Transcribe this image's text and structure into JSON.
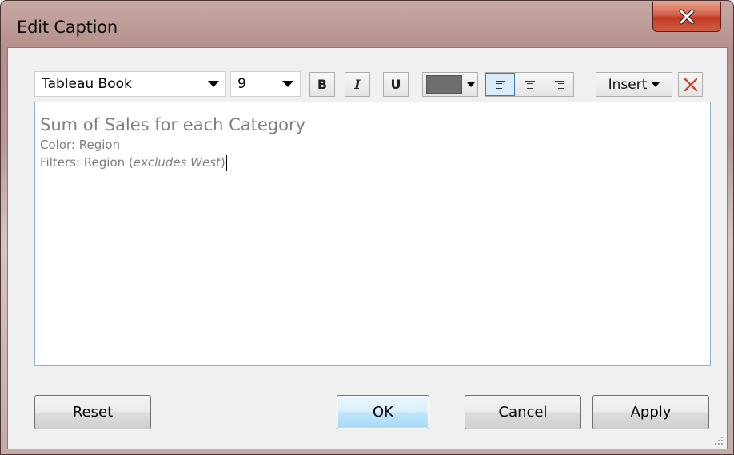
{
  "window": {
    "title": "Edit Caption"
  },
  "toolbar": {
    "font_family": "Tableau Book",
    "font_size": "9",
    "bold_label": "B",
    "italic_label": "I",
    "underline_label": "U",
    "text_color": "#6e6e6e",
    "insert_label": "Insert",
    "alignment_selected": "left"
  },
  "caption": {
    "title": "Sum of Sales for each Category",
    "color_line": "Color: Region",
    "filters_prefix": "Filters: Region (",
    "filters_italic": "excludes West",
    "filters_suffix": ")"
  },
  "buttons": {
    "reset": "Reset",
    "ok": "OK",
    "cancel": "Cancel",
    "apply": "Apply"
  },
  "icons": [
    "close-icon",
    "dropdown-arrow-icon",
    "align-left-icon",
    "align-center-icon",
    "align-right-icon",
    "clear-icon",
    "resize-grip-icon"
  ],
  "colors": {
    "close_button": "#c8452c",
    "clear_icon": "#d0462b",
    "caption_text": "#7f7f7f",
    "default_button_border": "#3c7fb1"
  }
}
